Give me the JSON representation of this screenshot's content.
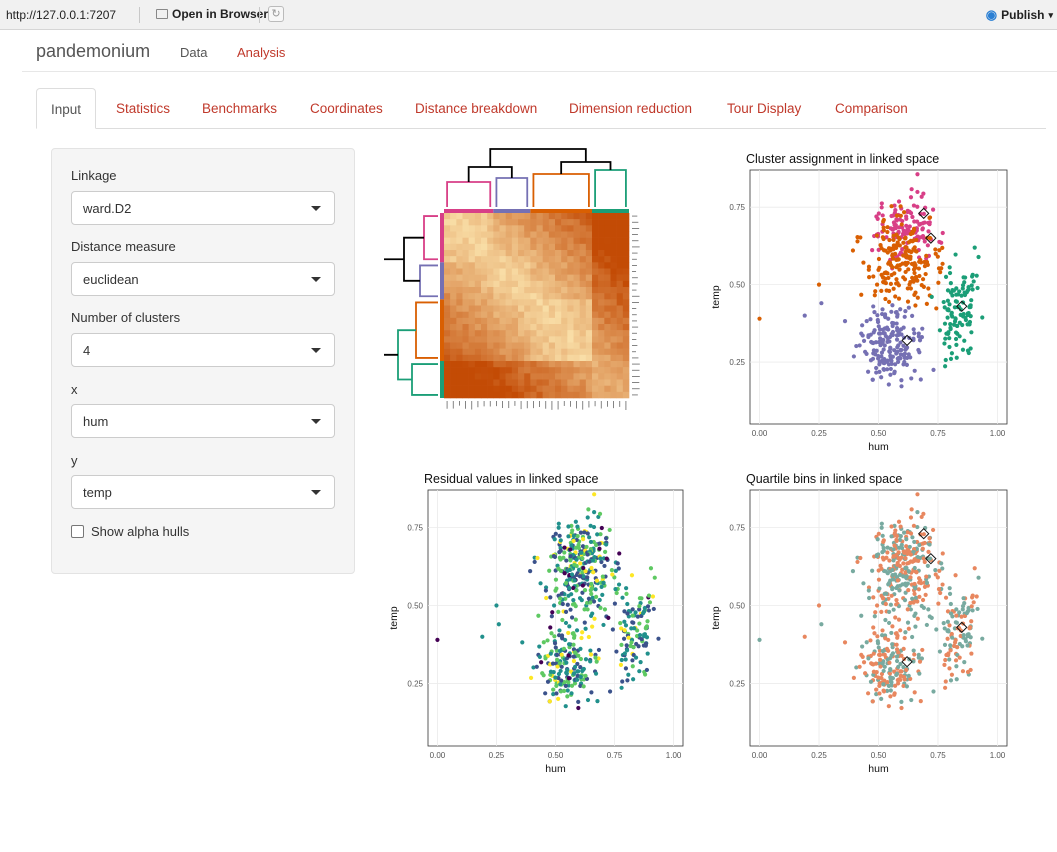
{
  "browser": {
    "url": "http://127.0.0.1:7207",
    "open_label": "Open in Browser",
    "publish_label": "Publish"
  },
  "navbar": {
    "brand": "pandemonium",
    "items": [
      "Data",
      "Analysis"
    ]
  },
  "tabs": [
    "Input",
    "Statistics",
    "Benchmarks",
    "Coordinates",
    "Distance breakdown",
    "Dimension reduction",
    "Tour Display",
    "Comparison"
  ],
  "sidebar": {
    "linkage": {
      "label": "Linkage",
      "value": "ward.D2"
    },
    "distance": {
      "label": "Distance measure",
      "value": "euclidean"
    },
    "clusters": {
      "label": "Number of clusters",
      "value": "4"
    },
    "x": {
      "label": "x",
      "value": "hum"
    },
    "y": {
      "label": "y",
      "value": "temp"
    },
    "alpha_label": "Show alpha hulls"
  },
  "plots": {
    "cluster_title": "Cluster assignment in linked space",
    "residual_title": "Residual values in linked space",
    "quartile_title": "Quartile bins in linked space",
    "xlabel": "hum",
    "ylabel": "temp",
    "x_ticks": [
      "0.00",
      "0.25",
      "0.50",
      "0.75",
      "1.00"
    ],
    "y_ticks": [
      "0.25",
      "0.50",
      "0.75"
    ]
  },
  "colors": {
    "accent": "#c0392b",
    "clusters": [
      "#d83f87",
      "#7570b3",
      "#d95f02",
      "#1b9e77"
    ],
    "quartile_a": "#e8875f",
    "quartile_b": "#78aaa0",
    "residual": [
      "#440154",
      "#3b528b",
      "#21908c",
      "#5ec962",
      "#fde725"
    ],
    "dendro_top": "#000000"
  },
  "chart_data": [
    {
      "type": "heatmap",
      "title": "",
      "note": "dendrogram-ordered distance matrix with 4 coloured cluster branches"
    },
    {
      "type": "scatter",
      "title": "Cluster assignment in linked space",
      "xlabel": "hum",
      "ylabel": "temp",
      "xlim": [
        0,
        1
      ],
      "ylim": [
        0.05,
        0.87
      ],
      "grid": true,
      "centroids": [
        [
          0.62,
          0.32
        ],
        [
          0.69,
          0.73
        ],
        [
          0.72,
          0.65
        ],
        [
          0.85,
          0.43
        ]
      ]
    },
    {
      "type": "scatter",
      "title": "Residual values in linked space",
      "xlabel": "hum",
      "ylabel": "temp",
      "xlim": [
        0,
        1
      ],
      "ylim": [
        0.05,
        0.87
      ],
      "grid": true
    },
    {
      "type": "scatter",
      "title": "Quartile bins in linked space",
      "xlabel": "hum",
      "ylabel": "temp",
      "xlim": [
        0,
        1
      ],
      "ylim": [
        0.05,
        0.87
      ],
      "grid": true,
      "centroids": [
        [
          0.62,
          0.32
        ],
        [
          0.69,
          0.73
        ],
        [
          0.72,
          0.65
        ],
        [
          0.85,
          0.43
        ]
      ]
    }
  ]
}
